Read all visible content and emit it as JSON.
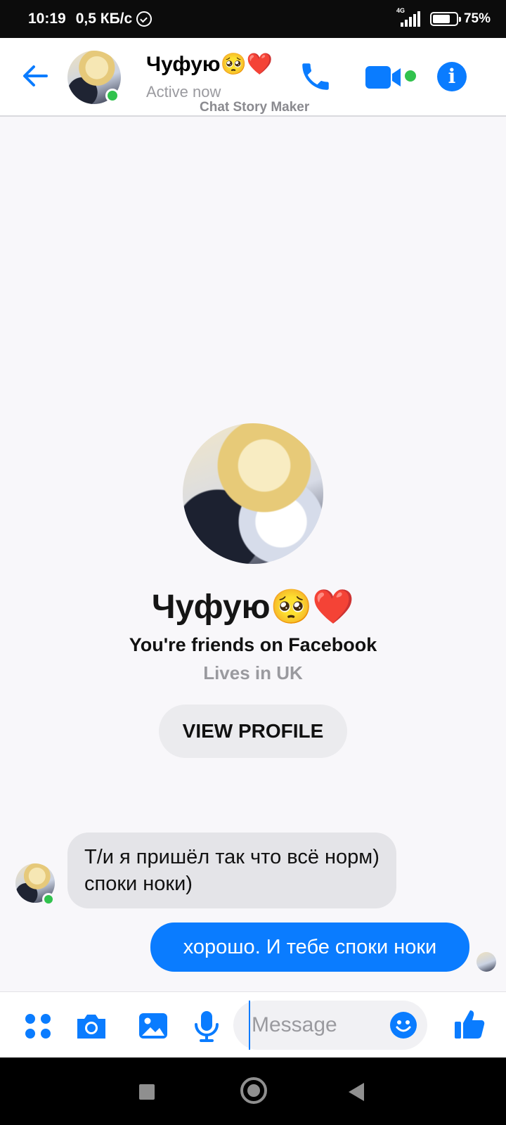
{
  "status_bar": {
    "time": "10:19",
    "speed": "0,5 КБ/с",
    "network": "4G",
    "battery": "75%",
    "battery_level": 0.75
  },
  "header": {
    "contact_name": "Чуфую🥺❤️",
    "status": "Active now",
    "watermark": "Chat Story Maker",
    "icons": [
      "back-arrow-icon",
      "phone-icon",
      "video-camera-icon",
      "info-icon"
    ],
    "accent_color": "#0a7cff",
    "online_color": "#31c24d"
  },
  "profile": {
    "name": "Чуфую🥺❤️",
    "relationship": "You're friends on Facebook",
    "location": "Lives in UK",
    "view_profile_label": "VIEW PROFILE"
  },
  "messages": [
    {
      "direction": "incoming",
      "text": "Т/и я пришёл так что всё норм) споки ноки)"
    },
    {
      "direction": "outgoing",
      "text": "хорошо. И тебе споки ноки"
    }
  ],
  "composer": {
    "placeholder": "Message",
    "icons": [
      "apps-icon",
      "camera-icon",
      "gallery-icon",
      "microphone-icon",
      "emoji-icon",
      "thumbs-up-icon"
    ]
  },
  "nav_bar": {
    "icons": [
      "recent-apps-icon",
      "home-icon",
      "back-icon"
    ]
  }
}
